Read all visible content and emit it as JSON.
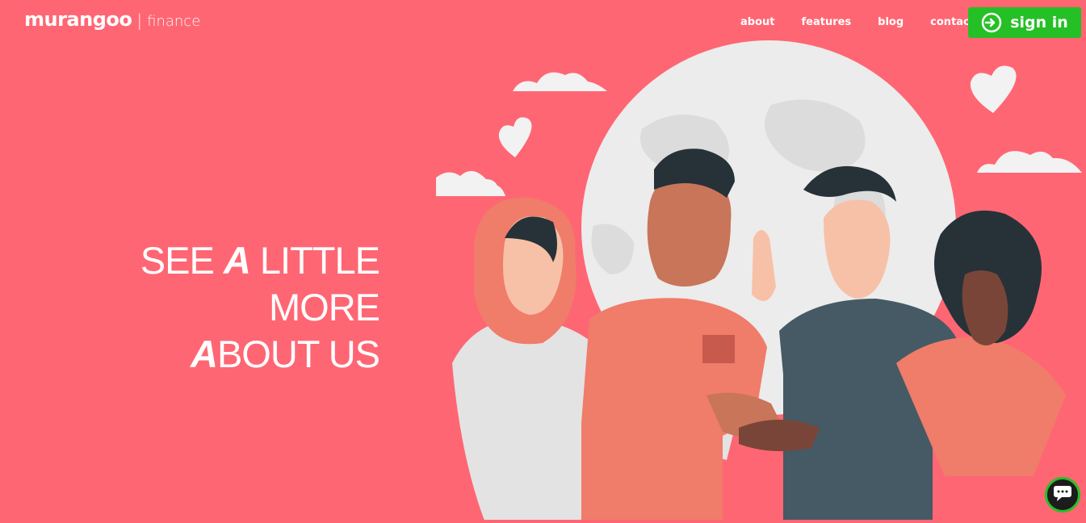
{
  "header": {
    "brand_name": "murangoo",
    "brand_separator": "|",
    "brand_sub": "finance",
    "nav": [
      {
        "label": "about"
      },
      {
        "label": "features"
      },
      {
        "label": "blog"
      },
      {
        "label": "contact"
      }
    ],
    "signin_label": "sign in",
    "signin_icon": "login-arrow-icon"
  },
  "hero": {
    "line1_a": "SEE ",
    "line1_b": "A",
    "line1_c": " LITTLE MORE",
    "line2_a": "A",
    "line2_b": "BOUT US"
  },
  "colors": {
    "background": "#ff6673",
    "signin": "#25c025",
    "text": "#ffffff"
  },
  "chat_icon": "chat-bubble-icon"
}
